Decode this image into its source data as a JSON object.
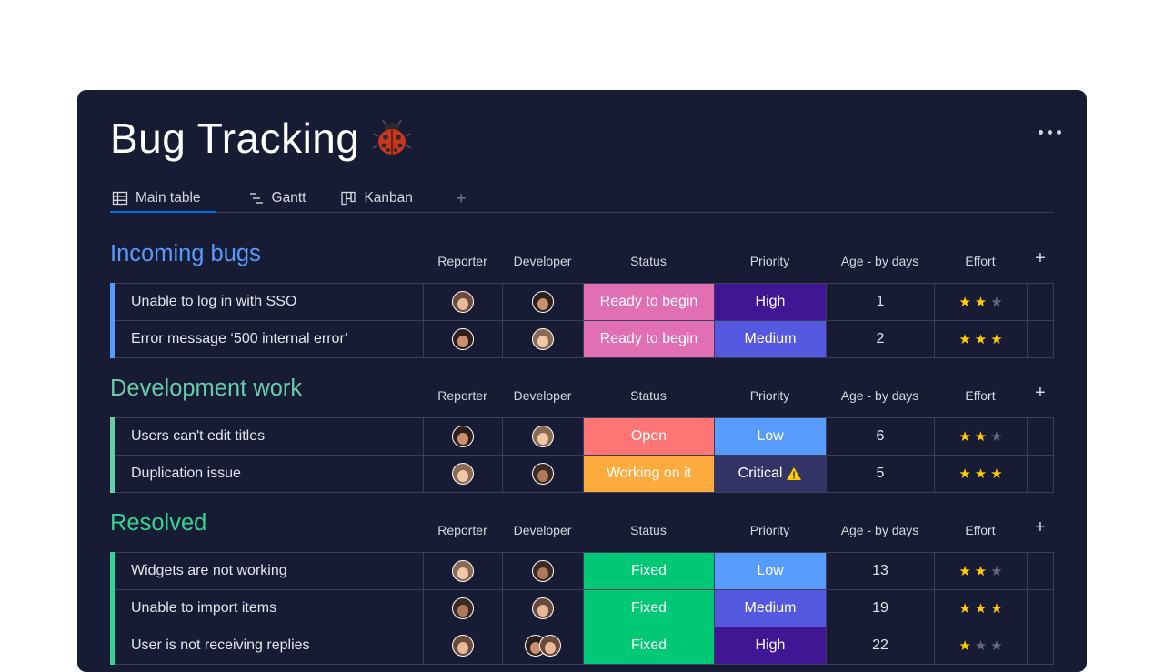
{
  "board": {
    "title": "Bug Tracking",
    "title_icon": "ladybug-icon",
    "more_icon": "more-options-icon"
  },
  "tabs": [
    {
      "label": "Main table",
      "icon": "table-icon",
      "active": true
    },
    {
      "label": "Gantt",
      "icon": "gantt-icon",
      "active": false
    },
    {
      "label": "Kanban",
      "icon": "kanban-icon",
      "active": false
    }
  ],
  "tab_add": "+",
  "columns": {
    "reporter": "Reporter",
    "developer": "Developer",
    "status": "Status",
    "priority": "Priority",
    "age": "Age - by days",
    "effort": "Effort",
    "add": "+"
  },
  "colors": {
    "ready_to_begin": "#e2445c",
    "open": "#f87171",
    "working_on_it": "#fdab3d",
    "fixed": "#00c875",
    "high": "#401694",
    "medium": "#5559df",
    "low": "#579bfc",
    "critical": "#333366"
  },
  "groups": [
    {
      "title": "Incoming bugs",
      "color": "#579bfc",
      "rows": [
        {
          "name": "Unable to log in with SSO",
          "status": "Ready to begin",
          "status_color": "#e16fb4",
          "priority": "High",
          "priority_color": "#401694",
          "age": "1",
          "effort": 2,
          "devs": 1
        },
        {
          "name": "Error message ‘500 internal error’",
          "status": "Ready to begin",
          "status_color": "#e16fb4",
          "priority": "Medium",
          "priority_color": "#5559df",
          "age": "2",
          "effort": 3,
          "devs": 1
        }
      ]
    },
    {
      "title": "Development work",
      "color": "#66ccaa",
      "rows": [
        {
          "name": "Users can't edit titles",
          "status": "Open",
          "status_color": "#ff7575",
          "priority": "Low",
          "priority_color": "#579bfc",
          "age": "6",
          "effort": 2,
          "devs": 1
        },
        {
          "name": "Duplication issue",
          "status": "Working on it",
          "status_color": "#fdab3d",
          "priority": "Critical",
          "priority_color": "#333366",
          "priority_warning": true,
          "age": "5",
          "effort": 3,
          "devs": 1
        }
      ]
    },
    {
      "title": "Resolved",
      "color": "#33d391",
      "rows": [
        {
          "name": "Widgets are not working",
          "status": "Fixed",
          "status_color": "#00c875",
          "priority": "Low",
          "priority_color": "#579bfc",
          "age": "13",
          "effort": 2,
          "devs": 1
        },
        {
          "name": "Unable to import items",
          "status": "Fixed",
          "status_color": "#00c875",
          "priority": "Medium",
          "priority_color": "#5559df",
          "age": "19",
          "effort": 3,
          "devs": 1
        },
        {
          "name": "User is not receiving replies",
          "status": "Fixed",
          "status_color": "#00c875",
          "priority": "High",
          "priority_color": "#401694",
          "age": "22",
          "effort": 1,
          "devs": 2
        }
      ]
    }
  ]
}
